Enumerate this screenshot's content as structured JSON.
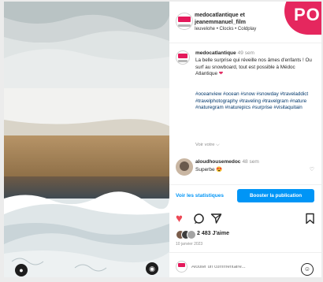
{
  "header": {
    "account_line1": "medocatlantique et",
    "account_line2": "jeanemmanuel_film",
    "audio": "Ieuvelohe • Clocks • Coldplay"
  },
  "overlay_badge": "PO",
  "caption": {
    "username": "medocatlantique",
    "time": "49 sem",
    "text": "La belle surprise qui réveille nos âmes d'enfants ! Ou surf au snowboard, tout est possible à Médoc Atlantique",
    "heart": "❤",
    "hashtags": "#oceanview #ocean #snow #snowday #traveladdict #travelphotography #traveling #travelgram #nature #naturegram #naturepics #surprise #visitaquitain",
    "see_translation": "Voir votre ⌵"
  },
  "comment": {
    "username": "aloudhousemedoc",
    "time": "48 sem",
    "text": "Superbe 😍"
  },
  "actions": {
    "stats_link": "Voir les statistiques",
    "boost_button": "Booster la publication"
  },
  "likes": {
    "count_text": "2 483 J'aime",
    "date": "10 janvier 2023"
  },
  "comment_box": {
    "placeholder": "Ajouter un commentaire..."
  },
  "colors": {
    "brand_pink": "#e5275e",
    "like_red": "#ed4956",
    "link_blue": "#0095f6"
  }
}
